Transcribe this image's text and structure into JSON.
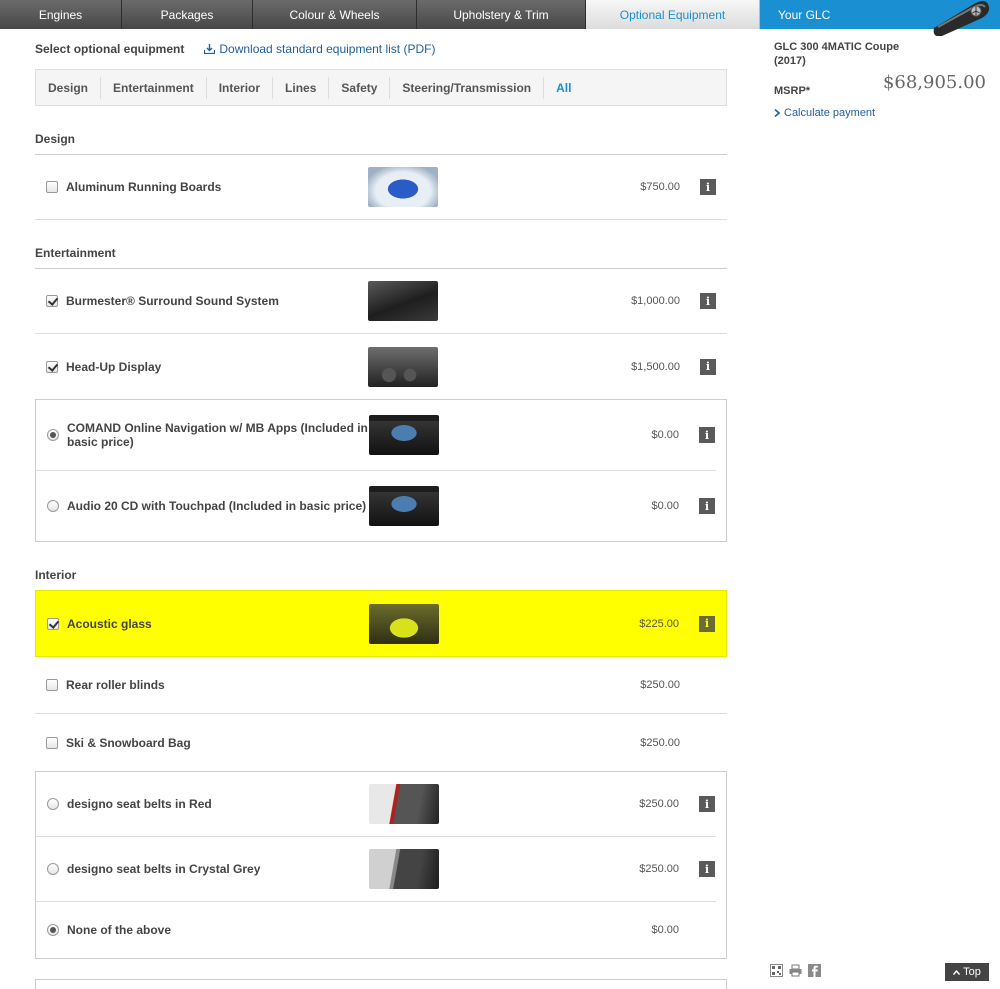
{
  "nav": {
    "tabs": [
      {
        "label": "Engines"
      },
      {
        "label": "Packages"
      },
      {
        "label": "Colour & Wheels"
      },
      {
        "label": "Upholstery & Trim"
      },
      {
        "label": "Optional Equipment",
        "active": true
      },
      {
        "label": "Your GLC"
      }
    ]
  },
  "header": {
    "title": "Select optional equipment",
    "download_link": "Download standard equipment list (PDF)"
  },
  "filters": [
    "Design",
    "Entertainment",
    "Interior",
    "Lines",
    "Safety",
    "Steering/Transmission",
    "All"
  ],
  "sections": {
    "design": {
      "title": "Design",
      "items": [
        {
          "label": "Aluminum Running Boards",
          "price": "$750.00",
          "checked": false
        }
      ]
    },
    "entertainment": {
      "title": "Entertainment",
      "items": [
        {
          "label": "Burmester® Surround Sound System",
          "price": "$1,000.00",
          "checked": true
        },
        {
          "label": "Head-Up Display",
          "price": "$1,500.00",
          "checked": true
        }
      ],
      "radio_items": [
        {
          "label": "COMAND Online Navigation w/ MB Apps (Included in basic price)",
          "price": "$0.00",
          "selected": true
        },
        {
          "label": "Audio 20 CD with Touchpad (Included in basic price)",
          "price": "$0.00",
          "selected": false
        }
      ]
    },
    "interior": {
      "title": "Interior",
      "items": [
        {
          "label": "Acoustic glass",
          "price": "$225.00",
          "checked": true,
          "highlight": "#ffff00"
        },
        {
          "label": "Rear roller blinds",
          "price": "$250.00",
          "checked": false
        },
        {
          "label": "Ski & Snowboard Bag",
          "price": "$250.00",
          "checked": false
        }
      ],
      "radio_items": [
        {
          "label": "designo seat belts in Red",
          "price": "$250.00",
          "selected": false
        },
        {
          "label": "designo seat belts in Crystal Grey",
          "price": "$250.00",
          "selected": false
        },
        {
          "label": "None of the above",
          "price": "$0.00",
          "selected": true
        }
      ]
    }
  },
  "summary": {
    "model": "GLC 300 4MATIC Coupe (2017)",
    "msrp_label": "MSRP*",
    "msrp_value": "$68,905.00",
    "calculate_link": "Calculate payment"
  },
  "footer": {
    "top_button": "Top",
    "icons": [
      "qr-code-icon",
      "print-icon",
      "facebook-icon"
    ]
  },
  "colors": {
    "accent": "#1a8fd1",
    "highlight": "#ffff00",
    "link": "#1f5fa0"
  }
}
